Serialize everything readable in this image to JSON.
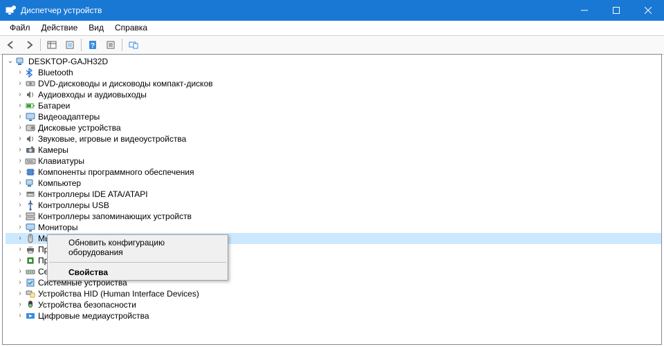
{
  "window": {
    "title": "Диспетчер устройств"
  },
  "menus": {
    "file": "Файл",
    "action": "Действие",
    "view": "Вид",
    "help": "Справка"
  },
  "root": {
    "name": "DESKTOP-GAJH32D"
  },
  "categories": [
    {
      "key": "bluetooth",
      "label": "Bluetooth",
      "icon": "bt"
    },
    {
      "key": "dvd",
      "label": "DVD-дисководы и дисководы компакт-дисков",
      "icon": "drive"
    },
    {
      "key": "audio",
      "label": "Аудиовходы и аудиовыходы",
      "icon": "speaker"
    },
    {
      "key": "battery",
      "label": "Батареи",
      "icon": "battery"
    },
    {
      "key": "display",
      "label": "Видеоадаптеры",
      "icon": "monitor"
    },
    {
      "key": "disk",
      "label": "Дисковые устройства",
      "icon": "disk"
    },
    {
      "key": "sgv",
      "label": "Звуковые, игровые и видеоустройства",
      "icon": "speaker"
    },
    {
      "key": "camera",
      "label": "Камеры",
      "icon": "camera"
    },
    {
      "key": "keyboard",
      "label": "Клавиатуры",
      "icon": "keyboard"
    },
    {
      "key": "software",
      "label": "Компоненты программного обеспечения",
      "icon": "chip"
    },
    {
      "key": "computer",
      "label": "Компьютер",
      "icon": "pc"
    },
    {
      "key": "ide",
      "label": "Контроллеры IDE ATA/ATAPI",
      "icon": "ide"
    },
    {
      "key": "usb",
      "label": "Контроллеры USB",
      "icon": "usb"
    },
    {
      "key": "storage",
      "label": "Контроллеры запоминающих устройств",
      "icon": "storage"
    },
    {
      "key": "monitor",
      "label": "Мониторы",
      "icon": "monitor"
    },
    {
      "key": "mouse",
      "label": "Мы",
      "icon": "mouse",
      "truncated": true
    },
    {
      "key": "print",
      "label": "Пр",
      "icon": "print",
      "truncated": true
    },
    {
      "key": "cpu",
      "label": "Пр",
      "icon": "cpu",
      "truncated": true
    },
    {
      "key": "network",
      "label": "Сетевые адаптеры",
      "icon": "net"
    },
    {
      "key": "system",
      "label": "Системные устройства",
      "icon": "system"
    },
    {
      "key": "hid",
      "label": "Устройства HID (Human Interface Devices)",
      "icon": "hid"
    },
    {
      "key": "security",
      "label": "Устройства безопасности",
      "icon": "security"
    },
    {
      "key": "media",
      "label": "Цифровые медиаустройства",
      "icon": "media"
    }
  ],
  "context_menu": {
    "target_index": 15,
    "items": [
      {
        "key": "scan",
        "label": "Обновить конфигурацию оборудования"
      },
      {
        "key": "props",
        "label": "Свойства",
        "bold": true
      }
    ]
  }
}
